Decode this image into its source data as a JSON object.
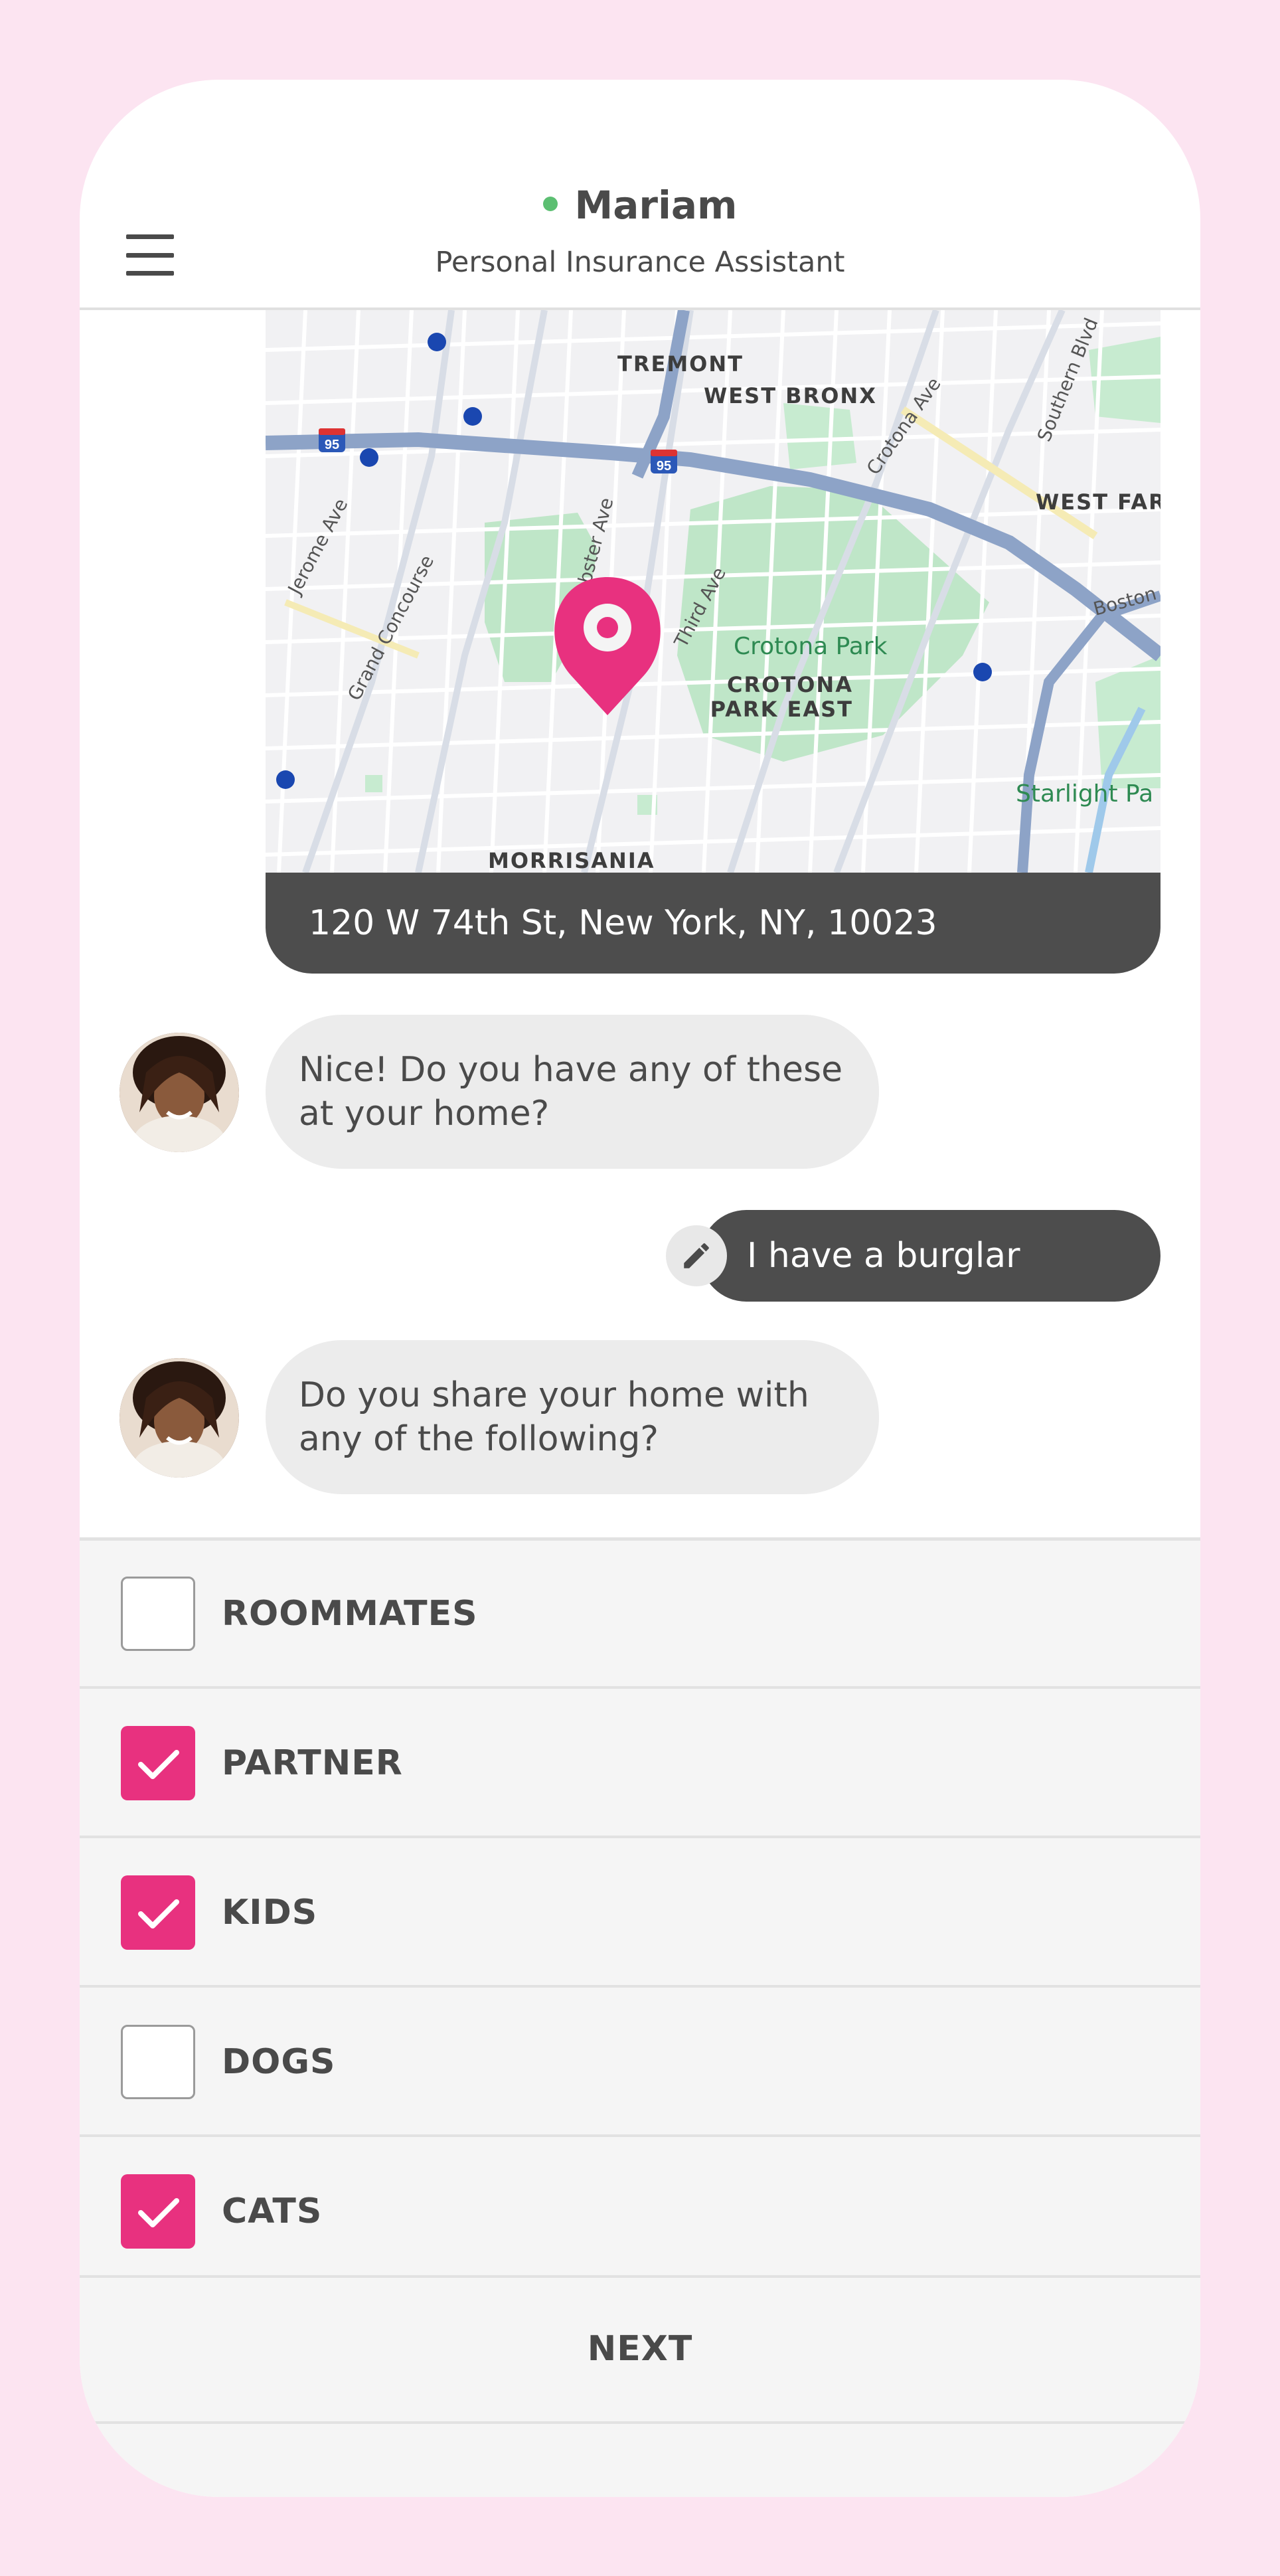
{
  "header": {
    "agent_name": "Mariam",
    "agent_subtitle": "Personal Insurance Assistant",
    "status": "online",
    "status_color": "#5cbf72"
  },
  "map": {
    "labels": {
      "tremont": "TREMONT",
      "west_bronx": "WEST BRONX",
      "west_farms": "WEST FAR",
      "crotona_park": "Crotona Park",
      "crotona_park_east_1": "CROTONA",
      "crotona_park_east_2": "PARK EAST",
      "morrisania": "MORRISANIA",
      "starlight": "Starlight Pa",
      "jerome_ave": "Jerome Ave",
      "grand_concourse": "Grand Concourse",
      "webster_ave": "ebster Ave",
      "third_ave": "Third Ave",
      "crotona_ave": "Crotona Ave",
      "southern_blvd": "Southern Blvd",
      "boston_rd": "Boston R",
      "interstate_1": "95",
      "interstate_2": "95"
    },
    "address": "120 W 74th St, New York, NY, 10023",
    "pin_color": "#e8317f"
  },
  "messages": [
    {
      "from": "agent",
      "text": "Nice! Do you have any of these at your home?"
    },
    {
      "from": "user",
      "text": "I have a burglar alarm"
    },
    {
      "from": "agent",
      "text": "Do you share your home with any of the following?"
    }
  ],
  "options": [
    {
      "label": "ROOMMATES",
      "checked": false
    },
    {
      "label": "PARTNER",
      "checked": true
    },
    {
      "label": "KIDS",
      "checked": true
    },
    {
      "label": "DOGS",
      "checked": false
    },
    {
      "label": "CATS",
      "checked": true
    }
  ],
  "next_label": "NEXT",
  "colors": {
    "accent": "#e8317f",
    "background": "#fce4f1",
    "bubble_dark": "#4d4d4d",
    "bubble_light": "#ececec"
  }
}
